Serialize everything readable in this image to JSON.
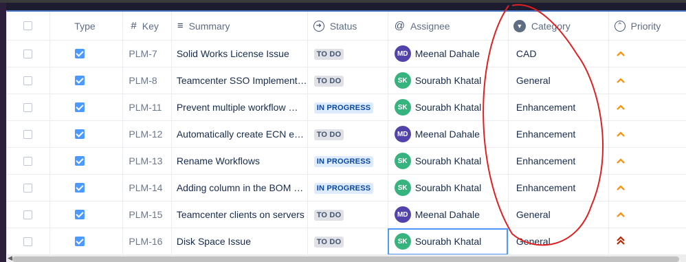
{
  "headers": {
    "type": "Type",
    "key": "Key",
    "summary": "Summary",
    "status": "Status",
    "assignee": "Assignee",
    "category": "Category",
    "priority": "Priority"
  },
  "rows": [
    {
      "key": "PLM-7",
      "summary": "Solid Works License Issue",
      "status": "TO DO",
      "status_kind": "todo",
      "assignee_initials": "MD",
      "assignee": "Meenal Dahale",
      "avatar_color": "#5243aa",
      "category": "CAD",
      "priority": "medium"
    },
    {
      "key": "PLM-8",
      "summary": "Teamcenter SSO Implement…",
      "status": "TO DO",
      "status_kind": "todo",
      "assignee_initials": "SK",
      "assignee": "Sourabh Khatal",
      "avatar_color": "#36b37e",
      "category": "General",
      "priority": "medium"
    },
    {
      "key": "PLM-11",
      "summary": "Prevent multiple workflow …",
      "status": "IN PROGRESS",
      "status_kind": "inprog",
      "assignee_initials": "SK",
      "assignee": "Sourabh Khatal",
      "avatar_color": "#36b37e",
      "category": "Enhancement",
      "priority": "medium"
    },
    {
      "key": "PLM-12",
      "summary": "Automatically create ECN e…",
      "status": "TO DO",
      "status_kind": "todo",
      "assignee_initials": "MD",
      "assignee": "Meenal Dahale",
      "avatar_color": "#5243aa",
      "category": "Enhancement",
      "priority": "medium"
    },
    {
      "key": "PLM-13",
      "summary": "Rename Workflows",
      "status": "IN PROGRESS",
      "status_kind": "inprog",
      "assignee_initials": "SK",
      "assignee": "Sourabh Khatal",
      "avatar_color": "#36b37e",
      "category": "Enhancement",
      "priority": "medium"
    },
    {
      "key": "PLM-14",
      "summary": "Adding column in the BOM …",
      "status": "IN PROGRESS",
      "status_kind": "inprog",
      "assignee_initials": "SK",
      "assignee": "Sourabh Khatal",
      "avatar_color": "#36b37e",
      "category": "Enhancement",
      "priority": "medium"
    },
    {
      "key": "PLM-15",
      "summary": "Teamcenter clients on servers",
      "status": "TO DO",
      "status_kind": "todo",
      "assignee_initials": "MD",
      "assignee": "Meenal Dahale",
      "avatar_color": "#5243aa",
      "category": "General",
      "priority": "medium"
    },
    {
      "key": "PLM-16",
      "summary": "Disk Space Issue",
      "status": "TO DO",
      "status_kind": "todo",
      "assignee_initials": "SK",
      "assignee": "Sourabh Khatal",
      "avatar_color": "#36b37e",
      "category": "General",
      "priority": "highest"
    }
  ],
  "colors": {
    "medium_priority": "#ff8b00",
    "highest_priority": "#bf2600",
    "annotation": "#e02020",
    "header_accent": "#4a78c9"
  },
  "icons": {
    "key_header": "hash-icon",
    "summary_header": "lines-icon",
    "status_header": "arrow-circle-icon",
    "assignee_header": "at-icon",
    "category_header": "chevron-down-filled-icon",
    "priority_header": "chevron-up-circle-icon"
  }
}
